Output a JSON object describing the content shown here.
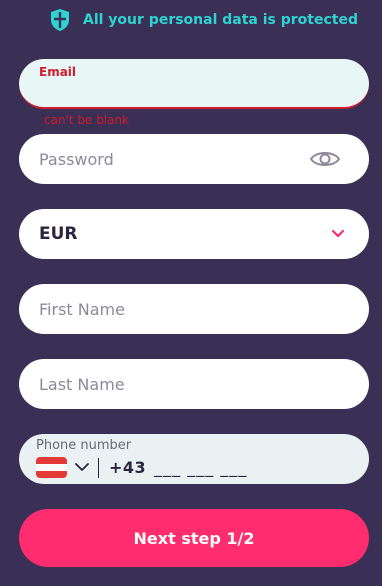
{
  "header": {
    "protected_text": "All your personal data is protected"
  },
  "form": {
    "email": {
      "label": "Email",
      "error": "can't be blank"
    },
    "password": {
      "placeholder": "Password"
    },
    "currency": {
      "value": "EUR"
    },
    "first_name": {
      "placeholder": "First Name"
    },
    "last_name": {
      "placeholder": "Last Name"
    },
    "phone": {
      "label": "Phone number",
      "code": "+43",
      "mask": "___ ___ ___"
    },
    "submit_label": "Next step 1/2"
  },
  "colors": {
    "background": "#3a2f55",
    "accent": "#ff2d6f",
    "teal": "#2fd3d0",
    "error": "#d11b2b"
  },
  "icons": [
    "shield-icon",
    "eye-icon",
    "chevron-down-icon",
    "austria-flag-icon"
  ]
}
